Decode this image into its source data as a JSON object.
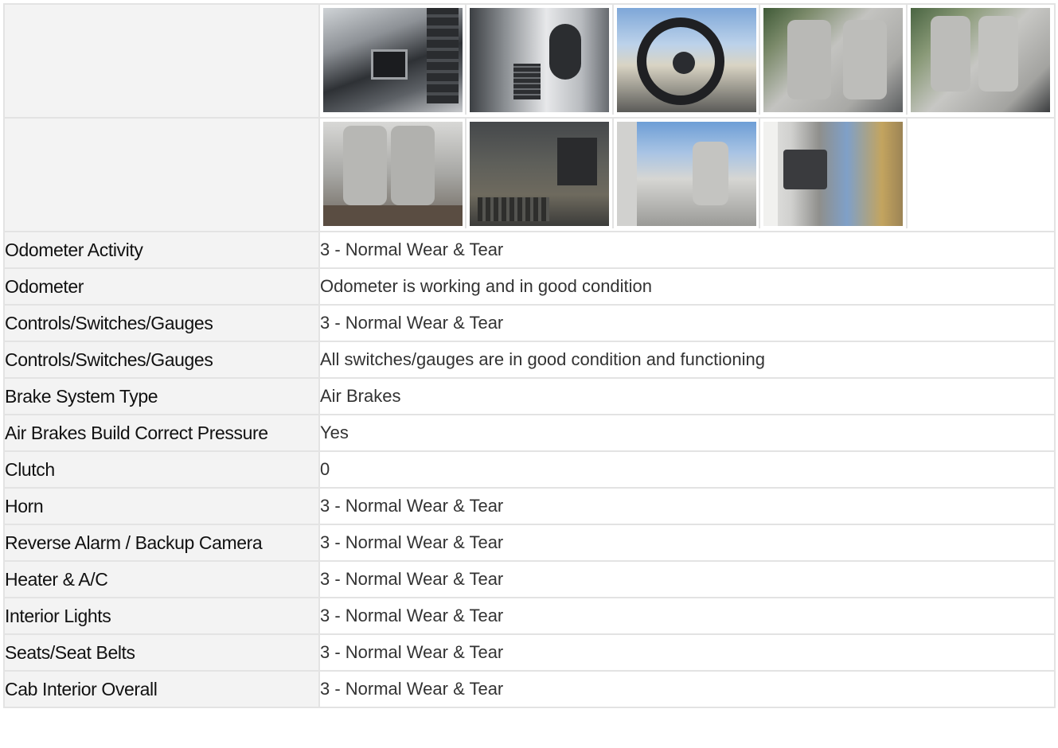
{
  "photos": {
    "row1": [
      "dashboard-photo",
      "door-panel-photo",
      "steering-wheel-photo",
      "seats-photo",
      "seats-side-photo"
    ],
    "row2": [
      "seat-bench-photo",
      "floor-photo",
      "cab-open-door-photo",
      "door-interior-photo"
    ]
  },
  "rows": [
    {
      "label": "Odometer Activity",
      "value": "3 - Normal Wear & Tear"
    },
    {
      "label": "Odometer",
      "value": "Odometer is working and in good condition"
    },
    {
      "label": "Controls/Switches/Gauges",
      "value": "3 - Normal Wear & Tear"
    },
    {
      "label": "Controls/Switches/Gauges",
      "value": "All switches/gauges are in good condition and functioning"
    },
    {
      "label": "Brake System Type",
      "value": "Air Brakes"
    },
    {
      "label": "Air Brakes Build Correct Pressure",
      "value": "Yes"
    },
    {
      "label": "Clutch",
      "value": "0"
    },
    {
      "label": "Horn",
      "value": "3 - Normal Wear & Tear"
    },
    {
      "label": "Reverse Alarm / Backup Camera",
      "value": "3 - Normal Wear & Tear"
    },
    {
      "label": "Heater & A/C",
      "value": "3 - Normal Wear & Tear"
    },
    {
      "label": "Interior Lights",
      "value": "3 - Normal Wear & Tear"
    },
    {
      "label": "Seats/Seat Belts",
      "value": "3 - Normal Wear & Tear"
    },
    {
      "label": "Cab Interior Overall",
      "value": "3 - Normal Wear & Tear"
    }
  ]
}
